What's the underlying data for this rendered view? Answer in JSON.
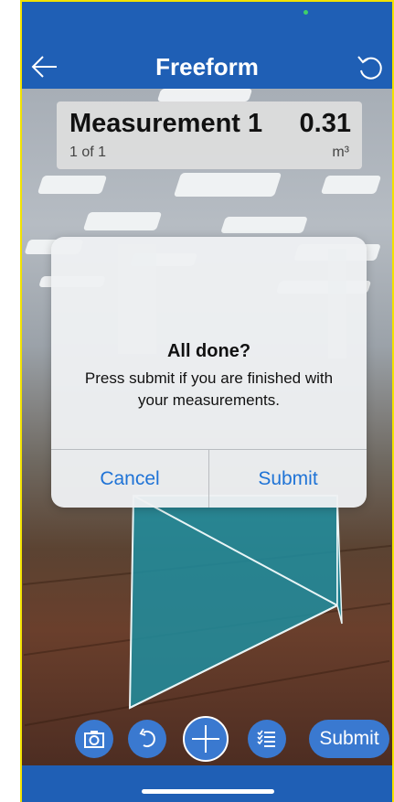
{
  "header": {
    "title": "Freeform",
    "back_icon": "arrow-left-icon",
    "undo_icon": "undo-icon"
  },
  "measurement": {
    "name": "Measurement 1",
    "value": "0.31",
    "index": "1 of 1",
    "unit": "m³"
  },
  "dialog": {
    "title": "All done?",
    "message": "Press submit if you are finished with your measurements.",
    "cancel_label": "Cancel",
    "submit_label": "Submit"
  },
  "toolbar": {
    "camera_icon": "camera-icon",
    "undo_icon": "undo-icon",
    "add_icon": "plus-icon",
    "list_icon": "list-icon",
    "submit_label": "Submit"
  },
  "colors": {
    "brand_blue": "#1f5fb5",
    "button_blue": "#3a79d0",
    "link_blue": "#1f73d6",
    "shape_fill": "#1e8ea0"
  }
}
